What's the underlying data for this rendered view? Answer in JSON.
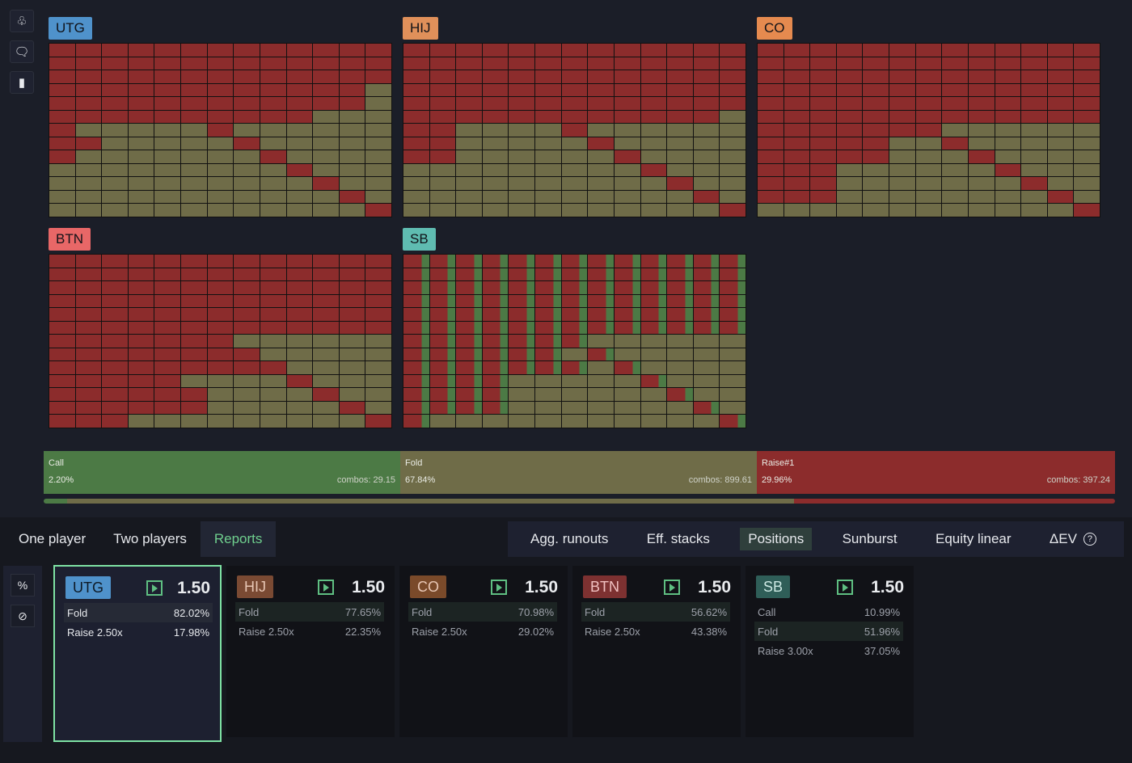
{
  "colors": {
    "fold": "#6f6c48",
    "raise": "#8c2c2c",
    "call": "#4c7a45",
    "utg": "#4f92cb",
    "hij": "#e0905a",
    "co": "#e58a4f",
    "btn": "#e86767",
    "sb": "#5fbcb1"
  },
  "toolbar_icons": [
    "club-icon",
    "comment-icon",
    "card-icon"
  ],
  "grids": [
    {
      "label": "UTG",
      "color": "#4f92cb",
      "raise_cols": [
        13,
        13,
        13,
        12,
        12,
        10,
        7,
        7,
        5,
        5,
        4,
        3,
        3
      ],
      "mixed": []
    },
    {
      "label": "HIJ",
      "color": "#e0905a",
      "raise_cols": [
        13,
        13,
        13,
        13,
        13,
        12,
        8,
        7,
        6,
        6,
        5,
        4,
        3
      ],
      "mixed": []
    },
    {
      "label": "CO",
      "color": "#e58a4f",
      "raise_cols": [
        13,
        13,
        13,
        13,
        13,
        13,
        12,
        10,
        9,
        9,
        8,
        7,
        6
      ],
      "mixed": []
    },
    {
      "label": "BTN",
      "color": "#e86767",
      "raise_cols": [
        13,
        13,
        13,
        13,
        13,
        13,
        13,
        12,
        12,
        11,
        11,
        10,
        9
      ],
      "mixed": []
    },
    {
      "label": "SB",
      "color": "#5fbcb1",
      "raise_cols": [
        13,
        13,
        13,
        13,
        13,
        13,
        12,
        11,
        11,
        10,
        9,
        8,
        7
      ],
      "mixed": [
        1
      ]
    }
  ],
  "actions": [
    {
      "label": "Call",
      "pct": "2.20%",
      "combos": "combos: 29.15"
    },
    {
      "label": "Fold",
      "pct": "67.84%",
      "combos": "combos: 899.61"
    },
    {
      "label": "Raise#1",
      "pct": "29.96%",
      "combos": "combos: 397.24"
    }
  ],
  "progress": {
    "call_fraction": 0.022,
    "fold_fraction": 0.6784,
    "raise_fraction": 0.2996
  },
  "tabs_left": [
    "One player",
    "Two players",
    "Reports"
  ],
  "tabs_right": [
    "Agg. runouts",
    "Eff. stacks",
    "Positions",
    "Sunburst",
    "Equity linear",
    "ΔEV"
  ],
  "help_glyph": "?",
  "bottom_tools": [
    {
      "icon": "percent-icon",
      "glyph": "%"
    },
    {
      "icon": "hide-icon",
      "glyph": "⊘"
    }
  ],
  "cards": [
    {
      "pos": "UTG",
      "value": "1.50",
      "rows": [
        {
          "action": "Fold",
          "pct": "82.02%"
        },
        {
          "action": "Raise 2.50x",
          "pct": "17.98%"
        }
      ]
    },
    {
      "pos": "HIJ",
      "value": "1.50",
      "rows": [
        {
          "action": "Fold",
          "pct": "77.65%"
        },
        {
          "action": "Raise 2.50x",
          "pct": "22.35%"
        }
      ]
    },
    {
      "pos": "CO",
      "value": "1.50",
      "rows": [
        {
          "action": "Fold",
          "pct": "70.98%"
        },
        {
          "action": "Raise 2.50x",
          "pct": "29.02%"
        }
      ]
    },
    {
      "pos": "BTN",
      "value": "1.50",
      "rows": [
        {
          "action": "Fold",
          "pct": "56.62%"
        },
        {
          "action": "Raise 2.50x",
          "pct": "43.38%"
        }
      ]
    },
    {
      "pos": "SB",
      "value": "1.50",
      "rows": [
        {
          "action": "Call",
          "pct": "10.99%"
        },
        {
          "action": "Fold",
          "pct": "51.96%"
        },
        {
          "action": "Raise 3.00x",
          "pct": "37.05%"
        }
      ]
    }
  ]
}
